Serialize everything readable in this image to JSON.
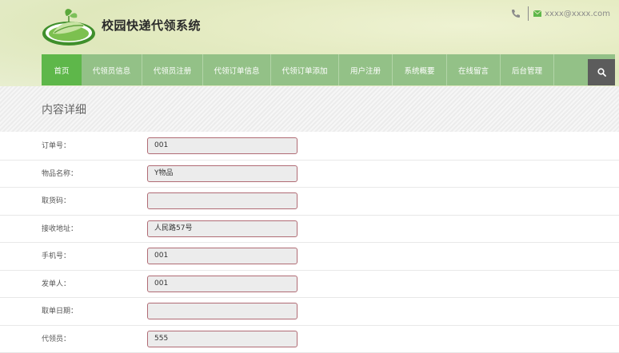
{
  "header": {
    "site_title": "校园快递代领系统",
    "email": "xxxx@xxxx.com",
    "phone_icon": "phone-icon",
    "mail_icon": "envelope-icon"
  },
  "nav": {
    "items": [
      {
        "label": "首页",
        "active": true
      },
      {
        "label": "代领员信息"
      },
      {
        "label": "代领员注册"
      },
      {
        "label": "代领订单信息"
      },
      {
        "label": "代领订单添加"
      },
      {
        "label": "用户注册"
      },
      {
        "label": "系统概要"
      },
      {
        "label": "在线留言"
      },
      {
        "label": "后台管理"
      }
    ],
    "search_icon": "search-icon"
  },
  "page": {
    "title": "内容详细"
  },
  "form": {
    "fields": [
      {
        "label": "订单号：",
        "value": "001"
      },
      {
        "label": "物品名称：",
        "value": "Y物品"
      },
      {
        "label": "取货码：",
        "value": ""
      },
      {
        "label": "接收地址：",
        "value": "人民路57号"
      },
      {
        "label": "手机号：",
        "value": "001"
      },
      {
        "label": "发单人：",
        "value": "001"
      },
      {
        "label": "取单日期：",
        "value": ""
      },
      {
        "label": "代领员：",
        "value": "555"
      }
    ]
  },
  "colors": {
    "nav_bg": "#93c187",
    "nav_active": "#5eb74a",
    "search_bg": "#5c5c5c",
    "field_border": "#b06b74"
  }
}
